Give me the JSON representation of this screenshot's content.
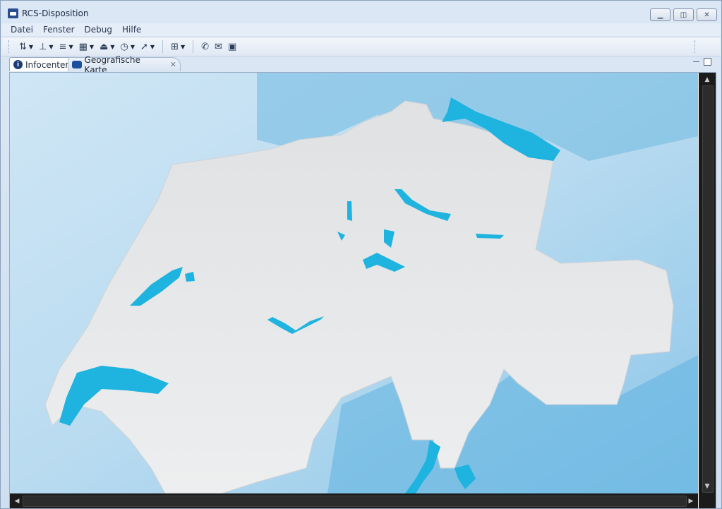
{
  "window": {
    "title": "RCS-Disposition",
    "controls": [
      "minimize-icon",
      "restore-icon",
      "close-icon"
    ]
  },
  "menu": [
    "Datei",
    "Fenster",
    "Debug",
    "Hilfe"
  ],
  "toolbar": {
    "groups": [
      {
        "icon": "north-arrow-icon"
      },
      {
        "icon": "align-icon"
      },
      {
        "icon": "line-style-icon"
      },
      {
        "icon": "grid-pattern-icon"
      },
      {
        "icon": "baseline-icon"
      },
      {
        "icon": "clock-icon"
      },
      {
        "icon": "pointer-arrow-icon"
      },
      {
        "icon": "table-layout-icon"
      },
      {
        "icon": "phone-icon"
      },
      {
        "icon": "envelope-icon"
      },
      {
        "icon": "contact-card-icon"
      }
    ]
  },
  "tabs": [
    {
      "label": "Infocenter",
      "active": true,
      "icon": "info-icon"
    },
    {
      "label": "Geografische Karte",
      "active": false,
      "icon": "map-icon"
    }
  ],
  "colors": {
    "water": "#1fb3df",
    "land": "#dcdfe2",
    "relief": "#9fcbe8",
    "scrollbar": "#1b1b1b"
  }
}
